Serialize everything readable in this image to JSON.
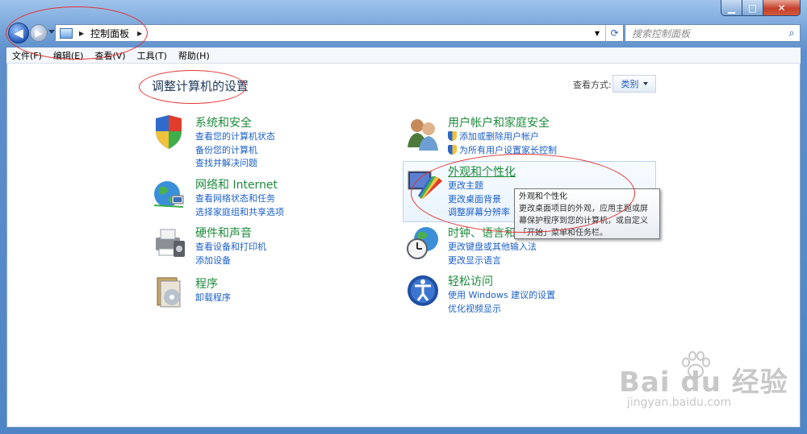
{
  "window": {
    "caption": {
      "minimize": "▁",
      "maximize": "□",
      "close": "✕"
    }
  },
  "nav": {
    "back_icon": "back-arrow-icon",
    "forward_icon": "forward-arrow-icon",
    "address": "控制面板",
    "search_placeholder": "搜索控制面板"
  },
  "menu": [
    "文件(F)",
    "编辑(E)",
    "查看(V)",
    "工具(T)",
    "帮助(H)"
  ],
  "content": {
    "title": "调整计算机的设置",
    "view_by_label": "查看方式:",
    "view_by_value": "类别"
  },
  "categories": {
    "system": {
      "title": "系统和安全",
      "links": [
        "查看您的计算机状态",
        "备份您的计算机",
        "查找并解决问题"
      ]
    },
    "network": {
      "title": "网络和 Internet",
      "links": [
        "查看网络状态和任务",
        "选择家庭组和共享选项"
      ]
    },
    "hardware": {
      "title": "硬件和声音",
      "links": [
        "查看设备和打印机",
        "添加设备"
      ]
    },
    "programs": {
      "title": "程序",
      "links": [
        "卸载程序"
      ]
    },
    "users": {
      "title": "用户帐户和家庭安全",
      "links": [
        "添加或删除用户帐户",
        "为所有用户设置家长控制"
      ]
    },
    "appearance": {
      "title": "外观和个性化",
      "links": [
        "更改主题",
        "更改桌面背景",
        "调整屏幕分辨率"
      ]
    },
    "clock": {
      "title": "时钟、语言和",
      "links": [
        "更改键盘或其他输入法",
        "更改显示语言"
      ]
    },
    "ease": {
      "title": "轻松访问",
      "links": [
        "使用 Windows 建议的设置",
        "优化视频显示"
      ]
    }
  },
  "tooltip": {
    "title": "外观和个性化",
    "line1": "更改桌面项目的外观，应用主题或屏",
    "line2": "幕保护程序到您的计算机，或自定义",
    "line3": "「开始」菜单和任务栏。"
  },
  "watermark": {
    "logo": "Bai du 经验",
    "url": "jingyan.baidu.com"
  }
}
